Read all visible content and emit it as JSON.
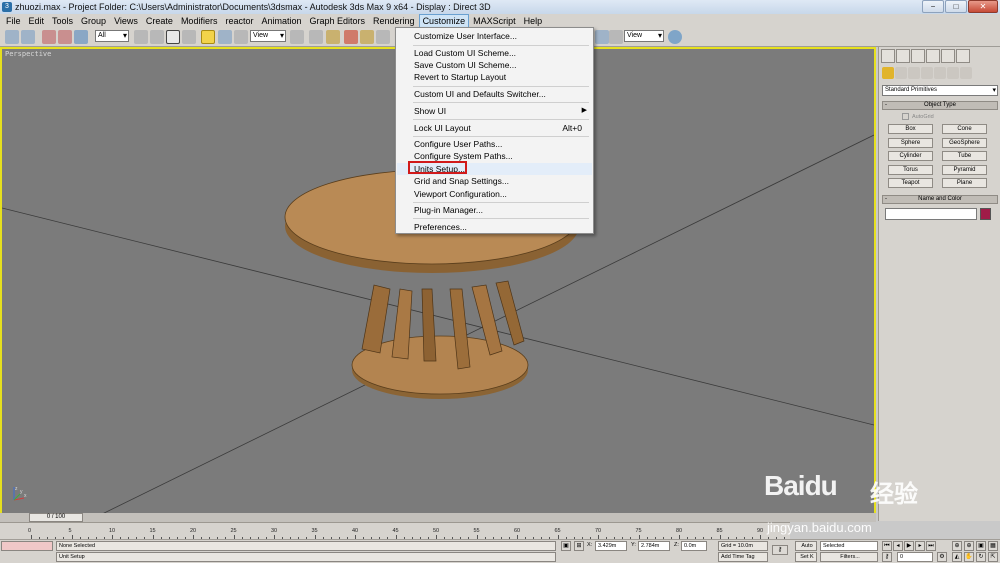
{
  "window": {
    "title": "zhuozi.max     - Project Folder: C:\\Users\\Administrator\\Documents\\3dsmax     - Autodesk 3ds Max 9 x64     - Display : Direct 3D",
    "icon_glyph": "3",
    "controls": {
      "minimize": "−",
      "maximize": "□",
      "close": "✕"
    }
  },
  "menubar": {
    "items": [
      {
        "label": "File"
      },
      {
        "label": "Edit"
      },
      {
        "label": "Tools"
      },
      {
        "label": "Group"
      },
      {
        "label": "Views"
      },
      {
        "label": "Create"
      },
      {
        "label": "Modifiers"
      },
      {
        "label": "reactor"
      },
      {
        "label": "Animation"
      },
      {
        "label": "Graph Editors"
      },
      {
        "label": "Rendering"
      },
      {
        "label": "Customize",
        "active": true
      },
      {
        "label": "MAXScript"
      },
      {
        "label": "Help"
      }
    ]
  },
  "toolbar": {
    "selection_filter": "All",
    "reference_coord": "View",
    "reference_coord_right": "View"
  },
  "viewport": {
    "label": "Perspective",
    "background": "#7b7b7b",
    "border_color": "#e6e01e",
    "axes": {
      "x": "x",
      "y": "y",
      "z": "z"
    }
  },
  "customize_menu": {
    "items": [
      {
        "label": "Customize User Interface...",
        "shortcut": "",
        "submenu": false
      },
      {
        "label": "Load Custom UI Scheme...",
        "shortcut": "",
        "submenu": false
      },
      {
        "label": "Save Custom UI Scheme...",
        "shortcut": "",
        "submenu": false
      },
      {
        "label": "Revert to Startup Layout",
        "shortcut": "",
        "submenu": false
      },
      {
        "label": "Custom UI and Defaults Switcher...",
        "shortcut": "",
        "submenu": false
      },
      {
        "label": "Show UI",
        "shortcut": "",
        "submenu": true
      },
      {
        "label": "Lock UI Layout",
        "shortcut": "Alt+0",
        "submenu": false
      },
      {
        "label": "Configure User Paths...",
        "shortcut": "",
        "submenu": false
      },
      {
        "label": "Configure System Paths...",
        "shortcut": "",
        "submenu": false
      },
      {
        "label": "Units Setup...",
        "shortcut": "",
        "submenu": false,
        "highlighted": true
      },
      {
        "label": "Grid and Snap Settings...",
        "shortcut": "",
        "submenu": false
      },
      {
        "label": "Viewport Configuration...",
        "shortcut": "",
        "submenu": false
      },
      {
        "label": "Plug-in Manager...",
        "shortcut": "",
        "submenu": false
      },
      {
        "label": "Preferences...",
        "shortcut": "",
        "submenu": false
      }
    ],
    "highlight_color": "#d11a1a"
  },
  "command_panel": {
    "category": "Standard Primitives",
    "object_type_title": "Object Type",
    "autogrid_label": "AutoGrid",
    "primitives": [
      "Box",
      "Cone",
      "Sphere",
      "GeoSphere",
      "Cylinder",
      "Tube",
      "Torus",
      "Pyramid",
      "Teapot",
      "Plane"
    ],
    "name_color_title": "Name and Color",
    "object_color": "#a01c48"
  },
  "timeline": {
    "slider_label": "0 / 100",
    "ticks": [
      "0",
      "5",
      "10",
      "15",
      "20",
      "25",
      "30",
      "35",
      "40",
      "45",
      "50",
      "55",
      "60",
      "65",
      "70",
      "75",
      "80",
      "85",
      "90"
    ]
  },
  "status": {
    "selection": "None Selected",
    "prompt": "Unit Setup",
    "x_label": "X:",
    "x_value": "3.429m",
    "y_label": "Y:",
    "y_value": "2.784m",
    "z_label": "Z:",
    "z_value": "0.0m",
    "grid": "Grid = 10.0m",
    "add_time_tag": "Add Time Tag",
    "auto_key": "Auto",
    "set_key": "Set K",
    "key_mode": "Selected",
    "key_filters": "Filters...",
    "frame": "0"
  },
  "watermark": {
    "brand": "Baidu",
    "brand_cn": "经验",
    "url": "jingyan.baidu.com"
  }
}
